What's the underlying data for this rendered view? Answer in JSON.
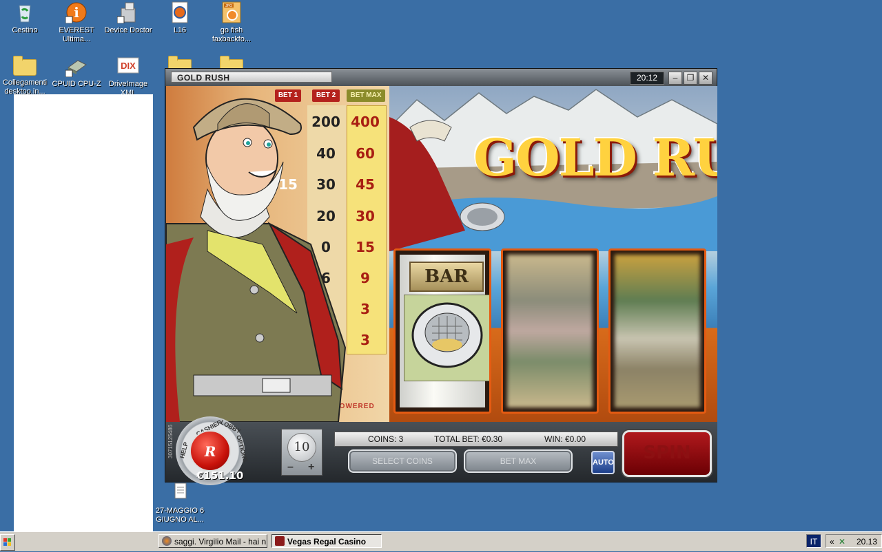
{
  "desktop": {
    "icons": [
      {
        "label": "Cestino"
      },
      {
        "label": "EVEREST Ultima..."
      },
      {
        "label": "Device Doctor"
      },
      {
        "label": "L16"
      },
      {
        "label": "go fish faxbackfo..."
      },
      {
        "label": "Collegamenti desktop.in..."
      },
      {
        "label": "CPUID CPU-Z"
      },
      {
        "label": "DriveImage XML"
      },
      {
        "label": "27-MAGGIO 6 GIUGNO AL..."
      }
    ]
  },
  "window": {
    "title": "GOLD RUSH",
    "clock": "20:12"
  },
  "game": {
    "logo": "GOLD RUSH",
    "paytable": {
      "headers": [
        "BET 1",
        "BET 2",
        "BET MAX"
      ],
      "rows": [
        [
          "200",
          "400"
        ],
        [
          "40",
          "60"
        ],
        [
          "15",
          "30",
          "45"
        ],
        [
          "20",
          "30"
        ],
        [
          "0",
          "15"
        ],
        [
          "6",
          "9"
        ],
        [
          "3"
        ],
        [
          "3"
        ]
      ],
      "powered": "POWERED"
    },
    "reel1_symbol": "BAR",
    "chip": {
      "labels": [
        "CASHIER",
        "LOBBY",
        "HELP",
        "OPTIONS"
      ],
      "balance": "€151.10",
      "side_id": "30715125486"
    },
    "coin_value": "10",
    "status": {
      "coins": "COINS: 3",
      "total_bet": "TOTAL BET: €0.30",
      "win": "WIN: €0.00"
    },
    "buttons": {
      "select_coins": "SELECT COINS",
      "bet_max": "BET MAX",
      "auto": "AUTO",
      "spin": "SPIN"
    }
  },
  "taskbar": {
    "tasks": [
      {
        "label": "saggi. Virgilio Mail - hai n..."
      },
      {
        "label": "Vegas Regal Casino"
      }
    ],
    "language": "IT",
    "time": "20.13"
  }
}
